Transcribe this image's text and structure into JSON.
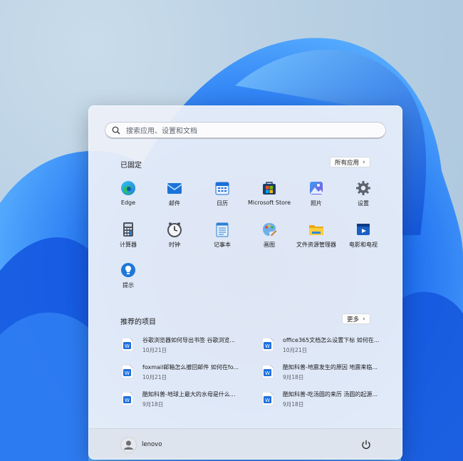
{
  "search": {
    "placeholder": "搜索应用、设置和文档"
  },
  "pinned": {
    "title": "已固定",
    "all_apps": "所有应用",
    "apps": [
      {
        "label": "Edge",
        "icon": "edge-icon"
      },
      {
        "label": "邮件",
        "icon": "mail-icon"
      },
      {
        "label": "日历",
        "icon": "calendar-icon"
      },
      {
        "label": "Microsoft Store",
        "icon": "store-icon"
      },
      {
        "label": "照片",
        "icon": "photos-icon"
      },
      {
        "label": "设置",
        "icon": "gear-icon"
      },
      {
        "label": "计算器",
        "icon": "calculator-icon"
      },
      {
        "label": "时钟",
        "icon": "clock-icon"
      },
      {
        "label": "记事本",
        "icon": "notepad-icon"
      },
      {
        "label": "画图",
        "icon": "paint-icon"
      },
      {
        "label": "文件资源管理器",
        "icon": "folder-icon"
      },
      {
        "label": "电影和电视",
        "icon": "movies-icon"
      },
      {
        "label": "提示",
        "icon": "tips-icon"
      }
    ]
  },
  "recommended": {
    "title": "推荐的项目",
    "more": "更多",
    "items": [
      {
        "title": "谷歌浏览器如何导出书签 谷歌浏览...",
        "date": "10月21日"
      },
      {
        "title": "office365文档怎么设置下标 如何在...",
        "date": "10月21日"
      },
      {
        "title": "foxmail邮箱怎么撤回邮件 如何在fo...",
        "date": "10月21日"
      },
      {
        "title": "酷知科普-地震发生的原因 地震来临...",
        "date": "9月18日"
      },
      {
        "title": "酷知科普-地球上最大的水母是什么...",
        "date": "9月18日"
      },
      {
        "title": "酷知科普-吃汤圆的来历 汤圆的起源...",
        "date": "9月18日"
      }
    ]
  },
  "user": {
    "name": "lenovo"
  },
  "colors": {
    "accent": "#0a64d8",
    "wallpaper": "#1f6ff0"
  }
}
